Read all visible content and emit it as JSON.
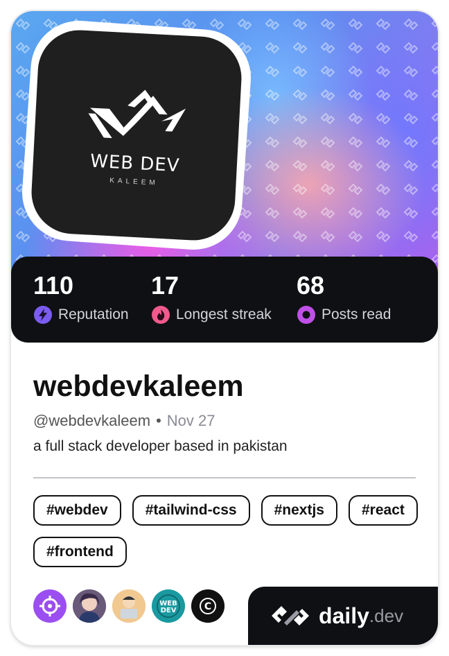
{
  "profile": {
    "avatar_logo": {
      "title": "WEB DEV",
      "subtitle": "KALEEM",
      "icon": "web-dev-logo-icon"
    },
    "name": "webdevkaleem",
    "handle": "@webdevkaleem",
    "separator": "•",
    "joined": "Nov 27",
    "bio": "a full stack developer based in pakistan"
  },
  "stats": [
    {
      "value": "110",
      "label": "Reputation",
      "icon": "lightning-icon",
      "color": "#7b5cf0"
    },
    {
      "value": "17",
      "label": "Longest streak",
      "icon": "flame-icon",
      "color": "#f05a8c"
    },
    {
      "value": "68",
      "label": "Posts read",
      "icon": "ring-icon",
      "color": "#c050e8"
    }
  ],
  "tags": [
    "#webdev",
    "#tailwind-css",
    "#nextjs",
    "#react",
    "#frontend"
  ],
  "squads": [
    {
      "icon": "crosshair-icon",
      "color": "#9b4ff0"
    },
    {
      "icon": "avatar-anime-icon",
      "color": "#4a3a5a"
    },
    {
      "icon": "avatar-laptop-icon",
      "color": "#e8c090"
    },
    {
      "icon": "web-dev-badge-icon",
      "color": "#1a9aa0",
      "text": "WEB DEV"
    },
    {
      "icon": "c-logo-icon",
      "color": "#111111",
      "text": "C"
    }
  ],
  "brand": {
    "name": "daily",
    "suffix": ".dev"
  },
  "colors": {
    "card_dark": "#0f1014",
    "accent_purple": "#7b5cf0"
  }
}
